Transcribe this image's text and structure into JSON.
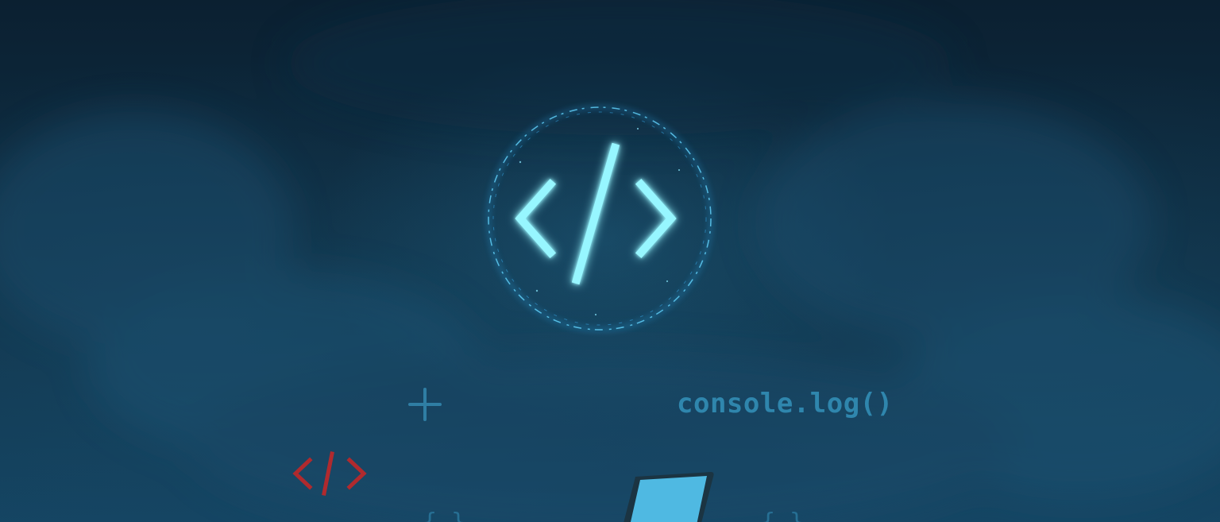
{
  "scene": {
    "center_icon": "code-tag-glow-icon",
    "floating_code": "console.log()",
    "left_icon": "plus-icon",
    "red_icon": "code-tag-icon",
    "bottom_object": "laptop-icon"
  },
  "colors": {
    "background_top": "#0b2031",
    "background_bottom": "#144462",
    "glow": "#8ff2ff",
    "glow_ring": "#48c6ff",
    "text_blue": "#2f86ad",
    "red_tag": "#b02a2e",
    "laptop_screen": "#4fb9e2"
  }
}
